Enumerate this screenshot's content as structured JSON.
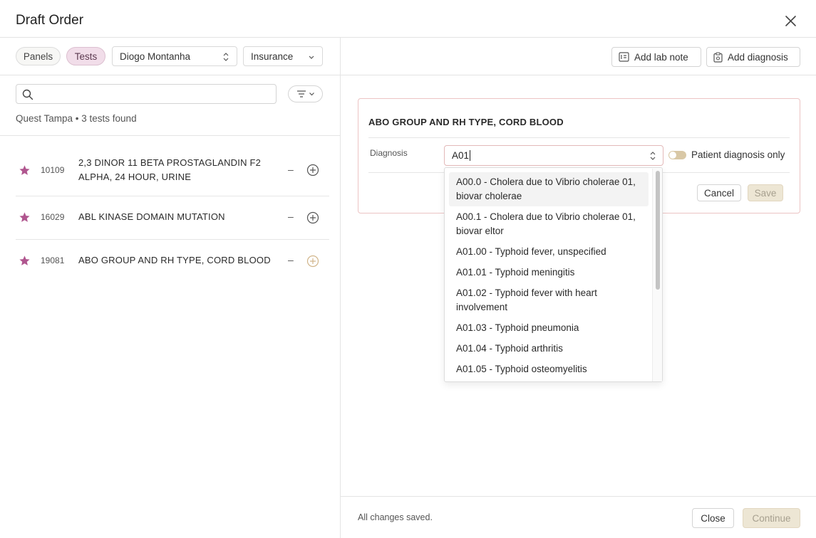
{
  "modal": {
    "title": "Draft Order"
  },
  "left": {
    "tabs": [
      {
        "label": "Panels",
        "active": false
      },
      {
        "label": "Tests",
        "active": true
      }
    ],
    "patient_select": "Diogo Montanha",
    "billing_select": "Insurance",
    "search": {
      "value": "",
      "placeholder": ""
    },
    "results_summary": "Quest Tampa • 3 tests found",
    "tests": [
      {
        "code": "10109",
        "name": "2,3 DINOR 11 BETA PROSTAGLANDIN F2 ALPHA, 24 HOUR, URINE",
        "dash": "–"
      },
      {
        "code": "16029",
        "name": "ABL KINASE DOMAIN MUTATION",
        "dash": "–"
      },
      {
        "code": "19081",
        "name": "ABO GROUP AND RH TYPE, CORD BLOOD",
        "dash": "–"
      }
    ]
  },
  "right": {
    "add_lab_note_label": "Add lab note",
    "add_diagnosis_label": "Add diagnosis",
    "card": {
      "test_name": "ABO GROUP AND RH TYPE, CORD BLOOD",
      "diagnosis_label": "Diagnosis",
      "diagnosis_value": "A01",
      "toggle_label": "Patient diagnosis only",
      "cancel_label": "Cancel",
      "save_label": "Save"
    },
    "dropdown_options": [
      "A00.0 - Cholera due to Vibrio cholerae 01, biovar cholerae",
      "A00.1 - Cholera due to Vibrio cholerae 01, biovar eltor",
      "A01.00 - Typhoid fever, unspecified",
      "A01.01 - Typhoid meningitis",
      "A01.02 - Typhoid fever with heart involvement",
      "A01.03 - Typhoid pneumonia",
      "A01.04 - Typhoid arthritis",
      "A01.05 - Typhoid osteomyelitis"
    ],
    "footer": {
      "status": "All changes saved.",
      "close_label": "Close",
      "continue_label": "Continue"
    }
  },
  "colors": {
    "accent_pink": "#b0568f",
    "tab_active_bg": "#f1dde9",
    "disabled_bg": "#ede6d4"
  }
}
